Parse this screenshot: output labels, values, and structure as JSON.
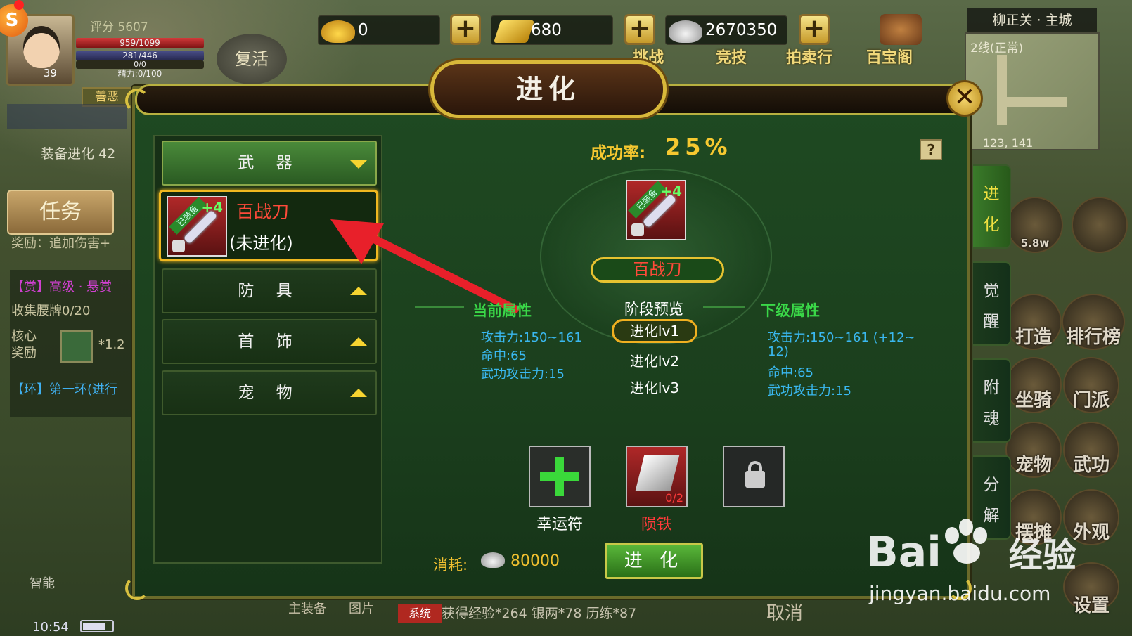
{
  "player": {
    "score_label": "评分 5607",
    "hp": "959/1099",
    "mp": "281/446",
    "exp": "0/0",
    "energy": "精力:0/100",
    "level": "39",
    "revive": "复活",
    "karma": "善恶"
  },
  "currencies": {
    "yuanbao": "0",
    "gold": "680",
    "silver": "2670350"
  },
  "top_icons": [
    "挑战",
    "竞技",
    "拍卖行",
    "百宝阁"
  ],
  "map": {
    "title": "柳正关 · 主城",
    "line": "2线(正常)",
    "coord": "123, 141"
  },
  "left_hud": {
    "equip_evolve": "装备进化 42",
    "task_button": "任务",
    "task_reward": "奖励：追加伤害+",
    "quest1": "【赏】高级 · 悬赏",
    "quest1_sub": "收集腰牌0/20",
    "core_reward_a": "核心",
    "core_reward_b": "奖励",
    "exp_mult": "*1.2",
    "quest2": "【环】第一环(进行",
    "smart": "智能",
    "clock": "10:54"
  },
  "right_icons": [
    "5.8w",
    "打造",
    "排行榜",
    "坐骑",
    "门派",
    "宠物",
    "武功",
    "摆摊",
    "外观",
    "设置"
  ],
  "dialog": {
    "title": "进化",
    "categories": [
      {
        "label": "武 器",
        "active": true
      },
      {
        "label": "防 具",
        "active": false
      },
      {
        "label": "首 饰",
        "active": false
      },
      {
        "label": "宠 物",
        "active": false
      }
    ],
    "item": {
      "name": "百战刀",
      "status": "(未进化)",
      "badge": "已装备",
      "plus": "+4"
    },
    "success_label": "成功率:",
    "success_value": "25%",
    "help": "?",
    "center_item_name": "百战刀",
    "current_attr_title": "当前属性",
    "stage_title": "阶段预览",
    "next_attr_title": "下级属性",
    "current_attrs": [
      "攻击力:150~161",
      "命中:65",
      "武功攻击力:15"
    ],
    "stages": [
      "进化lv1",
      "进化lv2",
      "进化lv3"
    ],
    "next_attrs": [
      "攻击力:150~161 (+12~",
      "12)",
      "命中:65",
      "武功攻击力:15"
    ],
    "slots": [
      {
        "label": "幸运符"
      },
      {
        "label": "陨铁",
        "count": "0/2"
      },
      {
        "label": ""
      }
    ],
    "cost_label": "消耗:",
    "cost_value": "80000",
    "evolve_button": "进 化",
    "side_tabs": [
      "进 化",
      "觉 醒",
      "附 魂",
      "分 解"
    ]
  },
  "bottom": {
    "main_equip": "主装备",
    "tag": "系统",
    "message": "获得经验*264 银两*78 历练*87",
    "cancel": "取消",
    "other": "图片"
  },
  "watermark": {
    "brand": "Bai",
    "brand2": "经验",
    "url": "jingyan.baidu.com"
  }
}
